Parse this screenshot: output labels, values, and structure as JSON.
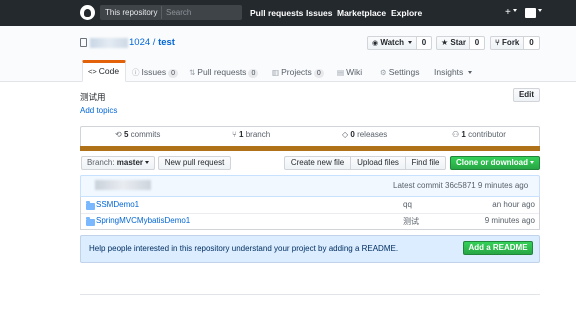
{
  "header": {
    "search_scope": "This repository",
    "search_placeholder": "Search",
    "nav": [
      "Pull requests",
      "Issues",
      "Marketplace",
      "Explore"
    ],
    "plus_label": "+"
  },
  "repo": {
    "owner_visible": "1024",
    "separator": " / ",
    "name": "test",
    "watch_label": "Watch",
    "watch_count": "0",
    "star_label": "Star",
    "star_count": "0",
    "fork_label": "Fork",
    "fork_count": "0"
  },
  "tabs": [
    {
      "label": "Code",
      "icon": "code-icon"
    },
    {
      "label": "Issues",
      "count": "0",
      "icon": "issue-icon"
    },
    {
      "label": "Pull requests",
      "count": "0",
      "icon": "pull-request-icon"
    },
    {
      "label": "Projects",
      "count": "0",
      "icon": "project-icon"
    },
    {
      "label": "Wiki",
      "icon": "book-icon"
    },
    {
      "label": "Settings",
      "icon": "gear-icon"
    },
    {
      "label": "Insights",
      "icon": "caret-icon"
    }
  ],
  "description": "测试用",
  "add_topics": "Add topics",
  "edit_label": "Edit",
  "summary": {
    "commits_num": "5",
    "commits_label": " commits",
    "branches_num": "1",
    "branches_label": " branch",
    "releases_num": "0",
    "releases_label": " releases",
    "contributors_num": "1",
    "contributors_label": " contributor"
  },
  "language_color": "#b07219",
  "file_nav": {
    "branch_prefix": "Branch: ",
    "branch": "master",
    "new_pr": "New pull request",
    "create_file": "Create new file",
    "upload_files": "Upload files",
    "find_file": "Find file",
    "clone": "Clone or download"
  },
  "latest_commit": "Latest commit 36c5871 9 minutes ago",
  "files": [
    {
      "name": "SSMDemo1",
      "message": "qq",
      "age": "an hour ago"
    },
    {
      "name": "SpringMVCMybatisDemo1",
      "message": "测试",
      "age": "9 minutes ago"
    }
  ],
  "readme": {
    "text": "Help people interested in this repository understand your project by adding a README.",
    "button": "Add a README"
  },
  "colors": {
    "header_bg": "#24292e",
    "link": "#0366d6",
    "selected_tab_accent": "#e36209",
    "green_button": "#28a745"
  }
}
